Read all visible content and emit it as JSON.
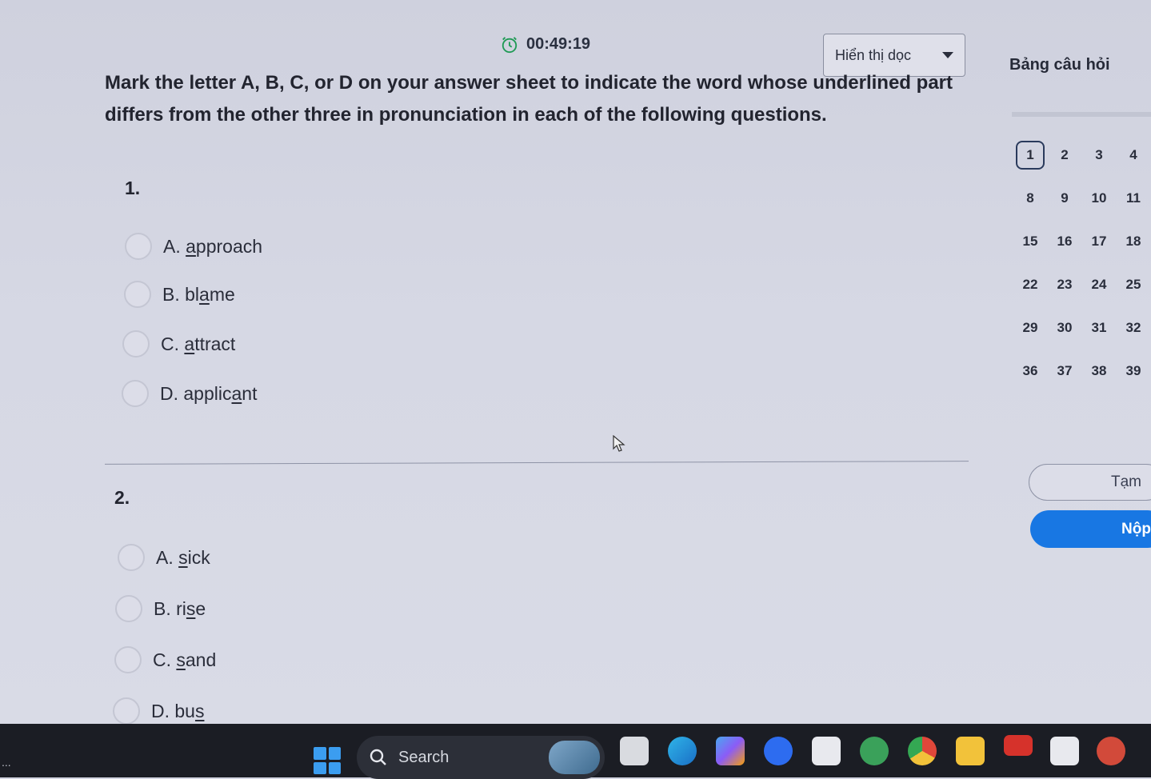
{
  "timer": {
    "value": "00:49:19",
    "icon": "alarm-clock-icon"
  },
  "read_mode": {
    "selected": "Hiển thị dọc"
  },
  "instructions": "Mark the letter A, B, C, or D on your answer sheet to indicate the word whose underlined part differs from the other three in pronunciation in each of the following questions.",
  "questions": [
    {
      "number": "1.",
      "options": [
        {
          "prefix": "A. ",
          "pre": "",
          "u": "a",
          "post": "pproach"
        },
        {
          "prefix": "B. ",
          "pre": "bl",
          "u": "a",
          "post": "me"
        },
        {
          "prefix": "C. ",
          "pre": "",
          "u": "a",
          "post": "ttract"
        },
        {
          "prefix": "D. ",
          "pre": "applic",
          "u": "a",
          "post": "nt"
        }
      ]
    },
    {
      "number": "2.",
      "options": [
        {
          "prefix": "A. ",
          "pre": "",
          "u": "s",
          "post": "ick"
        },
        {
          "prefix": "B. ",
          "pre": "ri",
          "u": "s",
          "post": "e"
        },
        {
          "prefix": "C. ",
          "pre": "",
          "u": "s",
          "post": "and"
        },
        {
          "prefix": "D. ",
          "pre": "bu",
          "u": "s",
          "post": ""
        }
      ]
    }
  ],
  "panel": {
    "title": "Bảng câu hỏi",
    "numbers": [
      "1",
      "2",
      "3",
      "4",
      "8",
      "9",
      "10",
      "11",
      "15",
      "16",
      "17",
      "18",
      "22",
      "23",
      "24",
      "25",
      "29",
      "30",
      "31",
      "32",
      "36",
      "37",
      "38",
      "39"
    ],
    "active": "1",
    "save_label": "Tạm",
    "submit_label": "Nộp"
  },
  "taskbar": {
    "search_label": "Search",
    "dots": "...",
    "apps": [
      "start-icon",
      "search-icon",
      "task-view-icon",
      "edge-icon",
      "copilot-icon",
      "zoom-icon",
      "store-icon",
      "app-icon",
      "chrome-icon",
      "file-explorer-icon",
      "youtube-icon",
      "calculator-icon",
      "office-icon"
    ],
    "colors": {
      "edge": "#1a8fd6",
      "zoom": "#2d6cf0",
      "chrome": "#e0473a",
      "explorer": "#f2c23a",
      "youtube": "#d6322b",
      "office": "#d24a3a"
    }
  }
}
